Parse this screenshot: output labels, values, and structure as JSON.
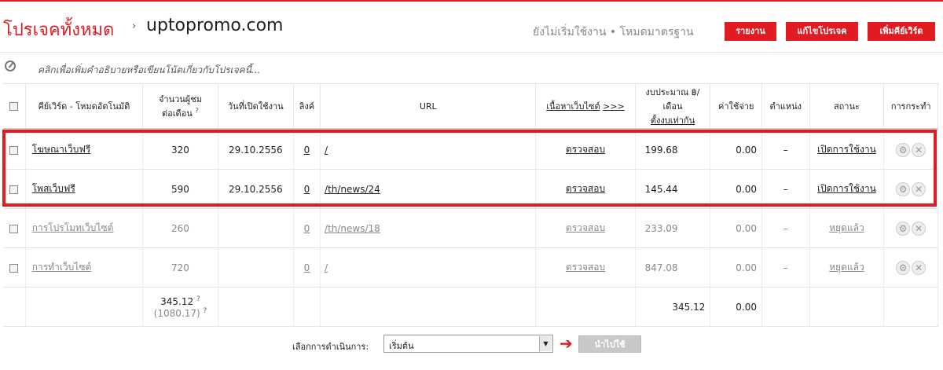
{
  "header": {
    "crumb_all": "โปรเจคทั้งหมด",
    "crumb_sep": "›",
    "domain": "uptopromo.com",
    "status_text": "ยังไม่เริ่มใช้งาน • โหมดมาตรฐาน",
    "btn_report": "รายงาน",
    "btn_edit": "แก้ไขโปรเจค",
    "btn_add": "เพิ่มคีย์เวิร์ด"
  },
  "description": {
    "placeholder": "คลิกเพื่อเพิ่มคำอธิบายหรือเขียนโน้ตเกี่ยวกับโปรเจคนี้..."
  },
  "table": {
    "headers": {
      "keyword": "คีย์เวิร์ด - โหมดอัตโนมัติ",
      "visitors_line1": "จำนวนผู้ชม",
      "visitors_line2": "ต่อเดือน",
      "visitors_q": "?",
      "start_date": "วันที่เปิดใช้งาน",
      "links": "ลิงค์",
      "url": "URL",
      "content_link": "เนื้อหาเว็บไซต์",
      "content_more": ">>>",
      "budget_line1": "งบประมาณ ฿/",
      "budget_line2": "เดือน",
      "budget_link": "ตั้งงบเท่ากัน",
      "cost": "ค่าใช้จ่าย",
      "position": "ตำแหน่ง",
      "status": "สถานะ",
      "actions": "การกระทำ"
    },
    "rows": [
      {
        "keyword": "โฆษณาเว็บฟรี",
        "visitors": "320",
        "date": "29.10.2556",
        "links": "0",
        "url": "/",
        "content": "ตรวจสอบ",
        "budget": "199.68",
        "cost": "0.00",
        "position": "–",
        "status": "เปิดการใช้งาน"
      },
      {
        "keyword": "โพสเว็บฟรี",
        "visitors": "590",
        "date": "29.10.2556",
        "links": "0",
        "url": "/th/news/24",
        "content": "ตรวจสอบ",
        "budget": "145.44",
        "cost": "0.00",
        "position": "–",
        "status": "เปิดการใช้งาน"
      },
      {
        "keyword": "การโปรโมทเว็บไซต์",
        "visitors": "260",
        "date": "",
        "links": "0",
        "url": "/th/news/18",
        "content": "ตรวจสอบ",
        "budget": "233.09",
        "cost": "0.00",
        "position": "–",
        "status": "หยุดแล้ว"
      },
      {
        "keyword": "การทำเว็บไซต์",
        "visitors": "720",
        "date": "",
        "links": "0",
        "url": "/",
        "content": "ตรวจสอบ",
        "budget": "847.08",
        "cost": "0.00",
        "position": "–",
        "status": "หยุดแล้ว"
      }
    ],
    "summary": {
      "visitors": "345.12",
      "visitors_q": "?",
      "visitors_total": "(1080.17)",
      "visitors_total_q": "?",
      "budget": "345.12",
      "cost": "0.00"
    }
  },
  "footer": {
    "label": "เลือกการดำเนินการ:",
    "select_value": "เริ่มต้น",
    "apply": "นำไปใช้"
  },
  "colors": {
    "accent": "#e01b22"
  }
}
